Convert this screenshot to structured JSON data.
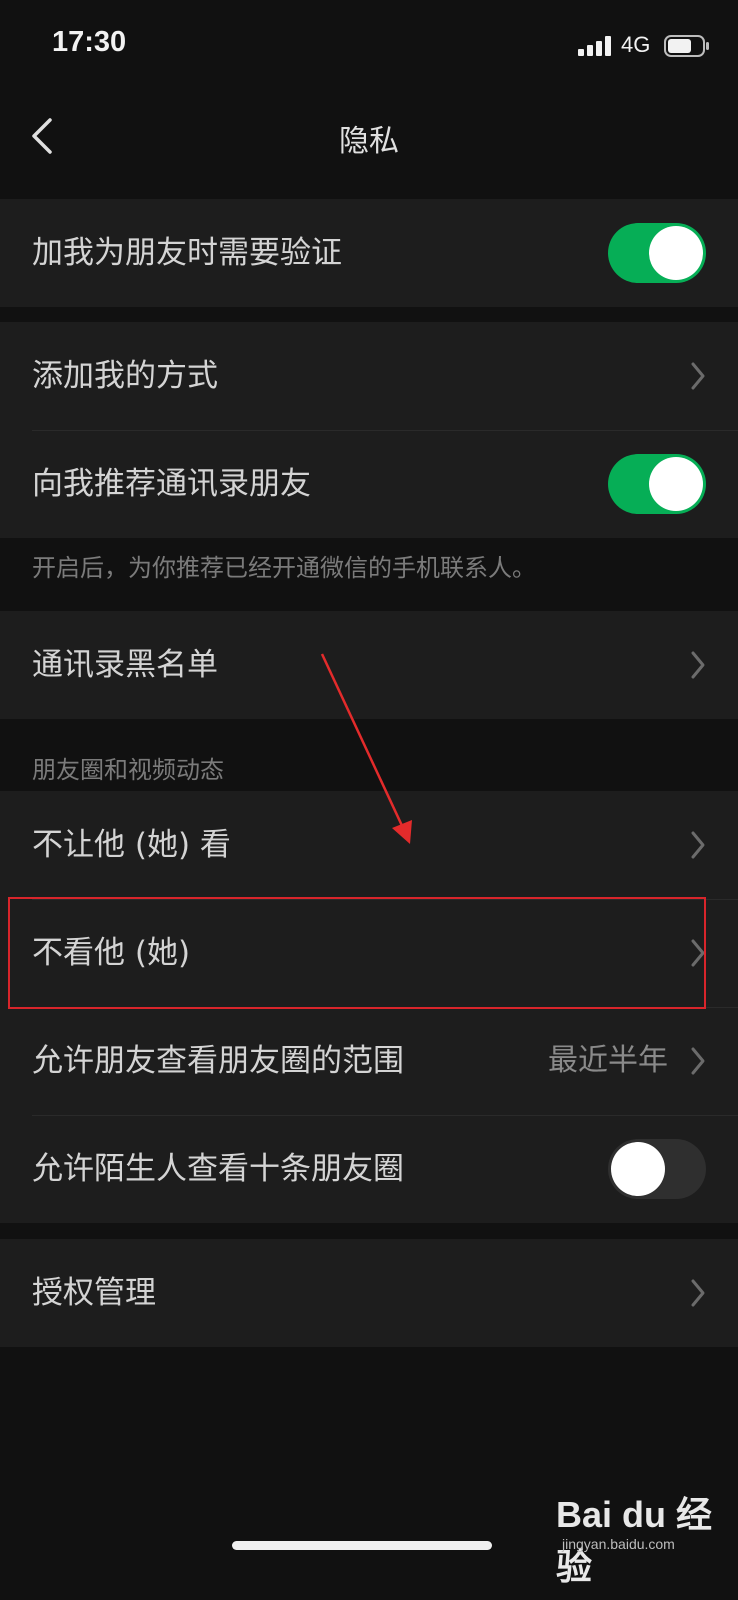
{
  "status_bar": {
    "time": "17:30",
    "network": "4G",
    "icons": [
      "signal-bars-icon",
      "battery-icon"
    ]
  },
  "nav": {
    "title": "隐私",
    "back_icon": "chevron-left-icon"
  },
  "groups": [
    {
      "cells": [
        {
          "label": "加我为朋友时需要验证",
          "type": "switch",
          "on": true
        }
      ]
    },
    {
      "cells": [
        {
          "label": "添加我的方式",
          "type": "link"
        },
        {
          "label": "向我推荐通讯录朋友",
          "type": "switch",
          "on": true
        }
      ],
      "footer": "开启后，为你推荐已经开通微信的手机联系人。"
    },
    {
      "cells": [
        {
          "label": "通讯录黑名单",
          "type": "link"
        }
      ]
    },
    {
      "header": "朋友圈和视频动态",
      "cells": [
        {
          "label": "不让他 (她) 看",
          "type": "link"
        },
        {
          "label": "不看他 (她)",
          "type": "link",
          "highlighted": true
        },
        {
          "label": "允许朋友查看朋友圈的范围",
          "type": "link",
          "value": "最近半年"
        },
        {
          "label": "允许陌生人查看十条朋友圈",
          "type": "switch",
          "on": false
        }
      ]
    },
    {
      "cells": [
        {
          "label": "授权管理",
          "type": "link"
        }
      ]
    }
  ],
  "annotation": {
    "highlight_color": "#d8252b",
    "arrow_color": "#e32b2b"
  },
  "watermark": {
    "logo_text": "Bai du 经验",
    "url": "jingyan.baidu.com"
  },
  "colors": {
    "background": "#111111",
    "cell": "#1d1d1d",
    "switch_on": "#06ae56",
    "switch_off": "#2f2f2f"
  }
}
